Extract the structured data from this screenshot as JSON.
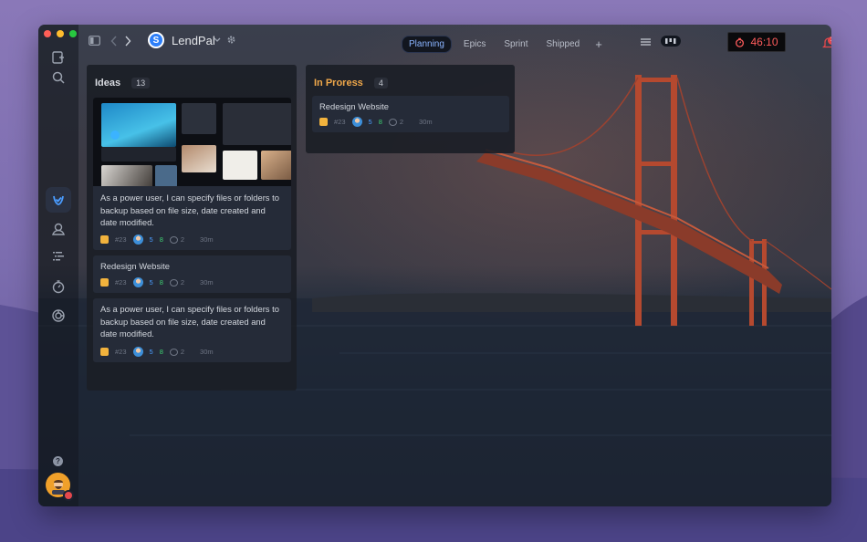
{
  "app": {
    "name": "LendPal",
    "logo_letter": "S"
  },
  "tabs": [
    {
      "label": "Planning",
      "active": true
    },
    {
      "label": "Epics",
      "active": false
    },
    {
      "label": "Sprint",
      "active": false
    },
    {
      "label": "Shipped",
      "active": false
    }
  ],
  "tab_add": "+",
  "timer": "46:10",
  "notifications_count": "12",
  "help_label": "?",
  "columns": {
    "ideas": {
      "title": "Ideas",
      "count": "13",
      "cards": [
        {
          "text": "As a power user, I can specify files or folders to backup based on file size, date created and date modified.",
          "id": "#23",
          "num_a": "5",
          "num_b": "8",
          "comments": "2",
          "estimate": "30m",
          "has_preview": true
        },
        {
          "text": "Redesign Website",
          "id": "#23",
          "num_a": "5",
          "num_b": "8",
          "comments": "2",
          "estimate": "30m"
        },
        {
          "text": "As a power user, I can specify files or folders to backup based on file size, date created and date modified.",
          "id": "#23",
          "num_a": "5",
          "num_b": "8",
          "comments": "2",
          "estimate": "30m"
        }
      ]
    },
    "in_progress": {
      "title": "In Proress",
      "count": "4",
      "cards": [
        {
          "text": "Redesign Website",
          "id": "#23",
          "num_a": "5",
          "num_b": "8",
          "comments": "2",
          "estimate": "30m"
        }
      ]
    }
  },
  "colors": {
    "accent": "#2d7ff9",
    "in_progress": "#f0a84a",
    "timer": "#ff5c5c",
    "badge": "#e5484d"
  },
  "icons": {
    "sidebar": [
      "new-note-icon",
      "search-icon",
      "tasks-check-icon",
      "user-icon",
      "list-icon",
      "stopwatch-icon",
      "sync-icon"
    ],
    "toolbar": [
      "sidebar-toggle-icon",
      "back-icon",
      "forward-icon",
      "chevron-down-icon",
      "settings-icon",
      "list-view-icon",
      "board-view-icon",
      "notification-icon",
      "menu-icon"
    ]
  }
}
